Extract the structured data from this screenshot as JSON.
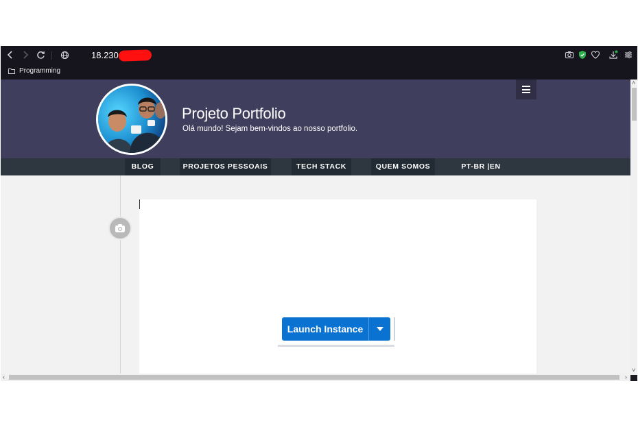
{
  "browser": {
    "url": "18.230.",
    "bookmark_folder": "Programming"
  },
  "site": {
    "title": "Projeto Portfolio",
    "subtitle": "Olá mundo! Sejam bem-vindos ao nosso portfolio."
  },
  "nav": {
    "items": [
      {
        "label": "BLOG"
      },
      {
        "label": "PROJETOS PESSOAIS"
      },
      {
        "label": "TECH STACK"
      },
      {
        "label": "QUEM SOMOS"
      },
      {
        "label": "PT-BR |EN"
      }
    ]
  },
  "content": {
    "launch_button": "Launch Instance"
  },
  "icons": {
    "back": "chevron-left-icon",
    "forward": "chevron-right-icon",
    "reload": "reload-icon",
    "site_info": "globe-icon",
    "screenshot": "camera-icon",
    "shield": "shield-icon",
    "favorites": "heart-icon",
    "downloads": "download-icon",
    "settings": "sliders-icon",
    "menu": "hamburger-icon",
    "photo": "camera-icon",
    "dropdown": "caret-down-icon"
  },
  "colors": {
    "header": "#3f3e5c",
    "navbar": "#2e3640",
    "accent": "#0a72d1",
    "shield": "#2fae4e"
  }
}
